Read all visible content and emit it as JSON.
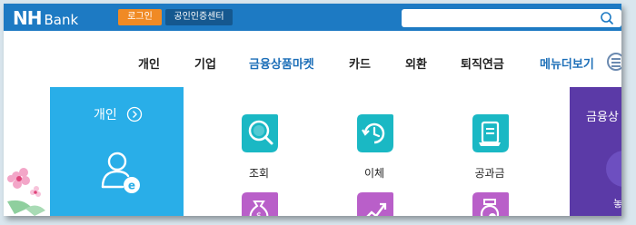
{
  "header": {
    "logo_nh": "NH",
    "logo_bank": "Bank",
    "login_label": "로그인",
    "cert_label": "공인인증센터",
    "search_placeholder": ""
  },
  "nav": {
    "items": [
      {
        "label": "개인"
      },
      {
        "label": "기업"
      },
      {
        "label": "금융상품마켓"
      },
      {
        "label": "카드"
      },
      {
        "label": "외환"
      },
      {
        "label": "퇴직연금"
      }
    ],
    "menu_label": "메뉴더보기"
  },
  "personal": {
    "title": "개인",
    "arrow_icon": "chevron-right-circle-icon",
    "person_icon": "user-e-icon"
  },
  "services": [
    {
      "label": "조회",
      "icon": "search-icon",
      "color": "#1ab8c4"
    },
    {
      "label": "이체",
      "icon": "transfer-clock-icon",
      "color": "#1ab8c4"
    },
    {
      "label": "공과금",
      "icon": "bill-icon",
      "color": "#1ab8c4"
    }
  ],
  "services_row2": [
    {
      "icon": "money-bag-icon",
      "color": "#b95fc9"
    },
    {
      "icon": "growth-chart-icon",
      "color": "#b95fc9"
    },
    {
      "icon": "coin-jar-icon",
      "color": "#b95fc9"
    }
  ],
  "side_panel": {
    "title": "금융상",
    "subtitle": "놓",
    "color": "#5b3aa7"
  },
  "colors": {
    "topbar": "#1d7ac3",
    "login": "#f08a24",
    "cert": "#15588f",
    "nav_active": "#1d6fb8",
    "personal_panel": "#29aee8"
  }
}
